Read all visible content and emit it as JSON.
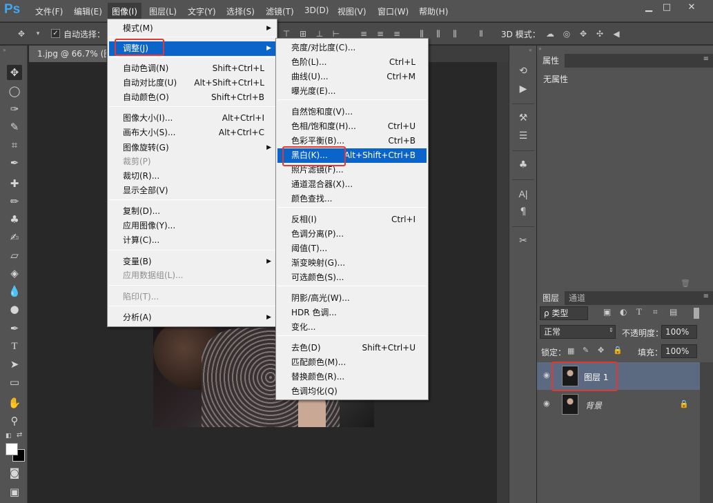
{
  "app": {
    "logo": "Ps"
  },
  "menubar": [
    {
      "label": "文件(F)"
    },
    {
      "label": "编辑(E)"
    },
    {
      "label": "图像(I)"
    },
    {
      "label": "图层(L)"
    },
    {
      "label": "文字(Y)"
    },
    {
      "label": "选择(S)"
    },
    {
      "label": "滤镜(T)"
    },
    {
      "label": "3D(D)"
    },
    {
      "label": "视图(V)"
    },
    {
      "label": "窗口(W)"
    },
    {
      "label": "帮助(H)"
    }
  ],
  "options": {
    "auto_select_label": "自动选择：",
    "mode_3d_label": "3D 模式："
  },
  "document": {
    "tab_title": "1.jpg @ 66.7% (图"
  },
  "image_menu": [
    {
      "label": "模式(M)",
      "shortcut": "",
      "submenu": true
    },
    {
      "label": "调整(J)",
      "shortcut": "",
      "submenu": true
    },
    {
      "label": "自动色调(N)",
      "shortcut": "Shift+Ctrl+L"
    },
    {
      "label": "自动对比度(U)",
      "shortcut": "Alt+Shift+Ctrl+L"
    },
    {
      "label": "自动颜色(O)",
      "shortcut": "Shift+Ctrl+B"
    },
    {
      "label": "图像大小(I)...",
      "shortcut": "Alt+Ctrl+I"
    },
    {
      "label": "画布大小(S)...",
      "shortcut": "Alt+Ctrl+C"
    },
    {
      "label": "图像旋转(G)",
      "shortcut": "",
      "submenu": true
    },
    {
      "label": "裁剪(P)",
      "shortcut": ""
    },
    {
      "label": "裁切(R)...",
      "shortcut": ""
    },
    {
      "label": "显示全部(V)",
      "shortcut": ""
    },
    {
      "label": "复制(D)...",
      "shortcut": ""
    },
    {
      "label": "应用图像(Y)...",
      "shortcut": ""
    },
    {
      "label": "计算(C)...",
      "shortcut": ""
    },
    {
      "label": "变量(B)",
      "shortcut": "",
      "submenu": true
    },
    {
      "label": "应用数据组(L)...",
      "shortcut": ""
    },
    {
      "label": "陷印(T)...",
      "shortcut": ""
    },
    {
      "label": "分析(A)",
      "shortcut": "",
      "submenu": true
    }
  ],
  "adjust_menu": [
    {
      "label": "亮度/对比度(C)...",
      "shortcut": ""
    },
    {
      "label": "色阶(L)...",
      "shortcut": "Ctrl+L"
    },
    {
      "label": "曲线(U)...",
      "shortcut": "Ctrl+M"
    },
    {
      "label": "曝光度(E)...",
      "shortcut": ""
    },
    {
      "label": "自然饱和度(V)...",
      "shortcut": ""
    },
    {
      "label": "色相/饱和度(H)...",
      "shortcut": "Ctrl+U"
    },
    {
      "label": "色彩平衡(B)...",
      "shortcut": "Ctrl+B"
    },
    {
      "label": "黑白(K)...",
      "shortcut": "Alt+Shift+Ctrl+B"
    },
    {
      "label": "照片滤镜(F)...",
      "shortcut": ""
    },
    {
      "label": "通道混合器(X)...",
      "shortcut": ""
    },
    {
      "label": "颜色查找...",
      "shortcut": ""
    },
    {
      "label": "反相(I)",
      "shortcut": "Ctrl+I"
    },
    {
      "label": "色调分离(P)...",
      "shortcut": ""
    },
    {
      "label": "阈值(T)...",
      "shortcut": ""
    },
    {
      "label": "渐变映射(G)...",
      "shortcut": ""
    },
    {
      "label": "可选颜色(S)...",
      "shortcut": ""
    },
    {
      "label": "阴影/高光(W)...",
      "shortcut": ""
    },
    {
      "label": "HDR 色调...",
      "shortcut": ""
    },
    {
      "label": "变化...",
      "shortcut": ""
    },
    {
      "label": "去色(D)",
      "shortcut": "Shift+Ctrl+U"
    },
    {
      "label": "匹配颜色(M)...",
      "shortcut": ""
    },
    {
      "label": "替换颜色(R)...",
      "shortcut": ""
    },
    {
      "label": "色调均化(Q)",
      "shortcut": ""
    }
  ],
  "properties": {
    "tab": "属性",
    "empty": "无属性"
  },
  "layers_panel": {
    "tab_layers": "图层",
    "tab_channels": "通道",
    "kind_label": "ρ 类型",
    "blend_mode": "正常",
    "opacity_label": "不透明度：",
    "opacity_value": "100%",
    "lock_label": "锁定：",
    "fill_label": "填充：",
    "fill_value": "100%",
    "layers": [
      {
        "name": "图层 1"
      },
      {
        "name": "背景"
      }
    ]
  },
  "colors": {
    "accent": "#0a64c9",
    "highlight_box": "#e2382f"
  }
}
